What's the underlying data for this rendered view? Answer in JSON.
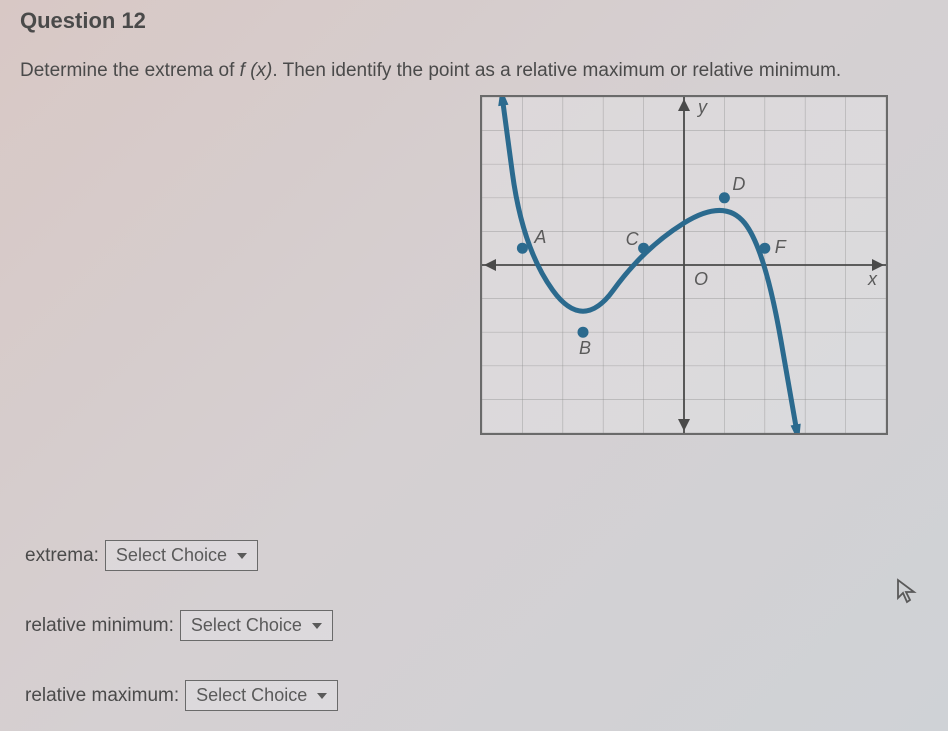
{
  "question": {
    "number_label": "Question 12",
    "prompt_prefix": "Determine the extrema of ",
    "fx": "f (x)",
    "prompt_suffix": ". Then identify the point as a relative maximum or relative minimum."
  },
  "answers": {
    "extrema_label": "extrema:",
    "min_label": "relative minimum:",
    "max_label": "relative maximum:",
    "select_placeholder": "Select Choice"
  },
  "chart_data": {
    "type": "line",
    "xlabel": "x",
    "ylabel": "y",
    "origin_label": "O",
    "xlim": [
      -5,
      5
    ],
    "ylim": [
      -5,
      5
    ],
    "grid": true,
    "points": [
      {
        "name": "A",
        "x": -4,
        "y": 0.5,
        "label_dx": 12,
        "label_dy": -5
      },
      {
        "name": "B",
        "x": -2.5,
        "y": -2,
        "label_dx": -4,
        "label_dy": 22
      },
      {
        "name": "C",
        "x": -1,
        "y": 0.5,
        "label_dx": -18,
        "label_dy": -3
      },
      {
        "name": "D",
        "x": 1,
        "y": 2,
        "label_dx": 8,
        "label_dy": -8
      },
      {
        "name": "F",
        "x": 2,
        "y": 0.5,
        "label_dx": 10,
        "label_dy": 5
      }
    ],
    "curve": [
      {
        "x": -4.5,
        "y": 5
      },
      {
        "x": -4,
        "y": 0.5
      },
      {
        "x": -2.5,
        "y": -2
      },
      {
        "x": -1,
        "y": 0.5
      },
      {
        "x": 1,
        "y": 2
      },
      {
        "x": 2,
        "y": 0.5
      },
      {
        "x": 2.8,
        "y": -5
      }
    ]
  }
}
